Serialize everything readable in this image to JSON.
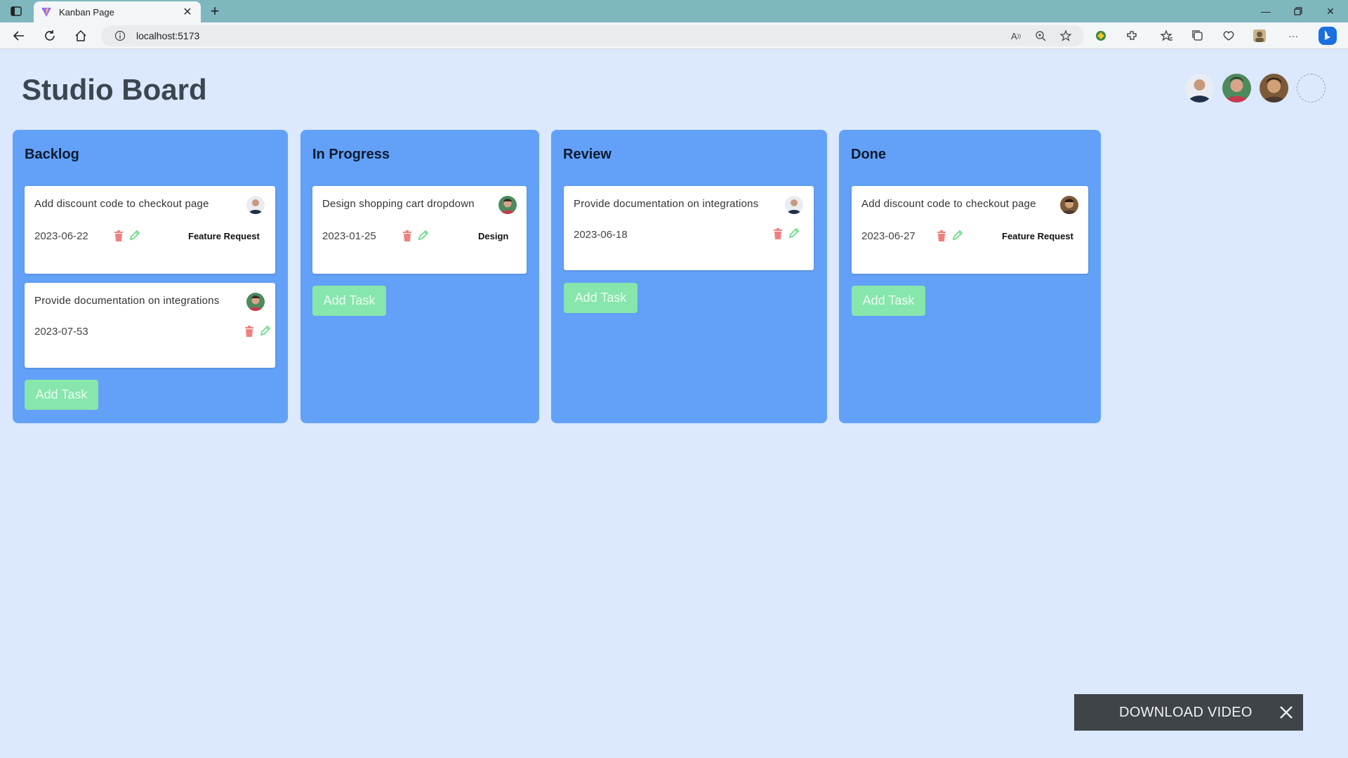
{
  "browser": {
    "tab_title": "Kanban Page",
    "url": "localhost:5173",
    "icons": [
      "sidebar-icon",
      "vite-favicon",
      "close-tab-icon",
      "new-tab-icon",
      "minimize-icon",
      "restore-icon",
      "close-window-icon",
      "back-icon",
      "refresh-icon",
      "home-icon",
      "info-icon",
      "read-aloud-icon",
      "zoom-icon",
      "favorite-icon",
      "extension-icon",
      "puzzle-icon",
      "favorites-icon",
      "collections-icon",
      "performance-icon",
      "profile-icon",
      "more-icon",
      "bing-icon"
    ]
  },
  "page": {
    "title": "Studio Board",
    "team_avatars": [
      "avatar-1",
      "avatar-2",
      "avatar-3",
      "avatar-empty"
    ]
  },
  "columns": [
    {
      "title": "Backlog",
      "add_label": "Add Task",
      "cards": [
        {
          "title": "Add discount code to checkout page",
          "date": "2023-06-22",
          "tag": "Feature Request"
        },
        {
          "title": "Provide documentation on integrations",
          "date": "2023-07-53",
          "tag": ""
        }
      ]
    },
    {
      "title": "In Progress",
      "add_label": "Add Task",
      "cards": [
        {
          "title": "Design shopping cart dropdown",
          "date": "2023-01-25",
          "tag": "Design"
        }
      ]
    },
    {
      "title": "Review",
      "add_label": "Add Task",
      "cards": [
        {
          "title": "Provide documentation on integrations",
          "date": "2023-06-18",
          "tag": ""
        }
      ]
    },
    {
      "title": "Done",
      "add_label": "Add Task",
      "cards": [
        {
          "title": "Add discount code to checkout page",
          "date": "2023-06-27",
          "tag": "Feature Request"
        }
      ]
    }
  ],
  "overlay": {
    "download_label": "DOWNLOAD VIDEO"
  },
  "colors": {
    "page_bg": "#dbe8fd",
    "column_bg": "#62a1f7",
    "add_button_bg": "#86e6ab",
    "trash": "#f08080",
    "pencil": "#6fdc8c"
  }
}
